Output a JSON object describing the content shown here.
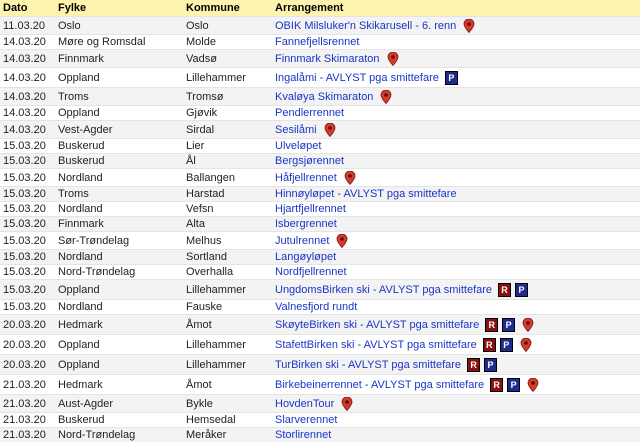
{
  "table": {
    "headers": {
      "date": "Dato",
      "fylke": "Fylke",
      "kommune": "Kommune",
      "arrangement": "Arrangement"
    },
    "rows": [
      {
        "date": "11.03.20",
        "fylke": "Oslo",
        "kommune": "Oslo",
        "event": "OBIK Milsluker'n Skikarusell - 6. renn",
        "badges": [],
        "map": true
      },
      {
        "date": "14.03.20",
        "fylke": "Møre og Romsdal",
        "kommune": "Molde",
        "event": "Fannefjellsrennet",
        "badges": [],
        "map": false
      },
      {
        "date": "14.03.20",
        "fylke": "Finnmark",
        "kommune": "Vadsø",
        "event": "Finnmark Skimaraton",
        "badges": [],
        "map": true
      },
      {
        "date": "14.03.20",
        "fylke": "Oppland",
        "kommune": "Lillehammer",
        "event": "Ingalåmi - AVLYST pga smittefare",
        "badges": [
          "P"
        ],
        "map": false
      },
      {
        "date": "14.03.20",
        "fylke": "Troms",
        "kommune": "Tromsø",
        "event": "Kvaløya Skimaraton",
        "badges": [],
        "map": true
      },
      {
        "date": "14.03.20",
        "fylke": "Oppland",
        "kommune": "Gjøvik",
        "event": "Pendlerrennet",
        "badges": [],
        "map": false
      },
      {
        "date": "14.03.20",
        "fylke": "Vest-Agder",
        "kommune": "Sirdal",
        "event": "Sesilåmi",
        "badges": [],
        "map": true
      },
      {
        "date": "15.03.20",
        "fylke": "Buskerud",
        "kommune": "Lier",
        "event": "Ulveløpet",
        "badges": [],
        "map": false
      },
      {
        "date": "15.03.20",
        "fylke": "Buskerud",
        "kommune": "Ål",
        "event": "Bergsjørennet",
        "badges": [],
        "map": false
      },
      {
        "date": "15.03.20",
        "fylke": "Nordland",
        "kommune": "Ballangen",
        "event": "Håfjellrennet",
        "badges": [],
        "map": true
      },
      {
        "date": "15.03.20",
        "fylke": "Troms",
        "kommune": "Harstad",
        "event": "Hinnøyløpet - AVLYST pga smittefare",
        "badges": [],
        "map": false
      },
      {
        "date": "15.03.20",
        "fylke": "Nordland",
        "kommune": "Vefsn",
        "event": "Hjartfjellrennet",
        "badges": [],
        "map": false
      },
      {
        "date": "15.03.20",
        "fylke": "Finnmark",
        "kommune": "Alta",
        "event": "Isbergrennet",
        "badges": [],
        "map": false
      },
      {
        "date": "15.03.20",
        "fylke": "Sør-Trøndelag",
        "kommune": "Melhus",
        "event": "Jutulrennet",
        "badges": [],
        "map": true
      },
      {
        "date": "15.03.20",
        "fylke": "Nordland",
        "kommune": "Sortland",
        "event": "Langøyløpet",
        "badges": [],
        "map": false
      },
      {
        "date": "15.03.20",
        "fylke": "Nord-Trøndelag",
        "kommune": "Overhalla",
        "event": "Nordfjellrennet",
        "badges": [],
        "map": false
      },
      {
        "date": "15.03.20",
        "fylke": "Oppland",
        "kommune": "Lillehammer",
        "event": "UngdomsBirken ski - AVLYST pga smittefare",
        "badges": [
          "R",
          "P"
        ],
        "map": false
      },
      {
        "date": "15.03.20",
        "fylke": "Nordland",
        "kommune": "Fauske",
        "event": "Valnesfjord rundt",
        "badges": [],
        "map": false
      },
      {
        "date": "20.03.20",
        "fylke": "Hedmark",
        "kommune": "Åmot",
        "event": "SkøyteBirken ski - AVLYST pga smittefare",
        "badges": [
          "R",
          "P"
        ],
        "map": true
      },
      {
        "date": "20.03.20",
        "fylke": "Oppland",
        "kommune": "Lillehammer",
        "event": "StafettBirken ski - AVLYST pga smittefare",
        "badges": [
          "R",
          "P"
        ],
        "map": true
      },
      {
        "date": "20.03.20",
        "fylke": "Oppland",
        "kommune": "Lillehammer",
        "event": "TurBirken ski - AVLYST pga smittefare",
        "badges": [
          "R",
          "P"
        ],
        "map": false
      },
      {
        "date": "21.03.20",
        "fylke": "Hedmark",
        "kommune": "Åmot",
        "event": "Birkebeinerrennet - AVLYST pga smittefare",
        "badges": [
          "R",
          "P"
        ],
        "map": true
      },
      {
        "date": "21.03.20",
        "fylke": "Aust-Agder",
        "kommune": "Bykle",
        "event": "HovdenTour",
        "badges": [],
        "map": true
      },
      {
        "date": "21.03.20",
        "fylke": "Buskerud",
        "kommune": "Hemsedal",
        "event": "Slarverennet",
        "badges": [],
        "map": false
      },
      {
        "date": "21.03.20",
        "fylke": "Nord-Trøndelag",
        "kommune": "Meråker",
        "event": "Storlirennet",
        "badges": [],
        "map": false
      }
    ]
  },
  "colors": {
    "header_bg": "#fff3b0",
    "link": "#1a35c8",
    "badge_r": "#8b0f0f",
    "badge_p": "#1f2a8f",
    "map_pin": "#d63a2f"
  },
  "icons": {
    "map": "map-pin-icon",
    "R": "registration-badge-icon",
    "P": "parking-badge-icon"
  }
}
